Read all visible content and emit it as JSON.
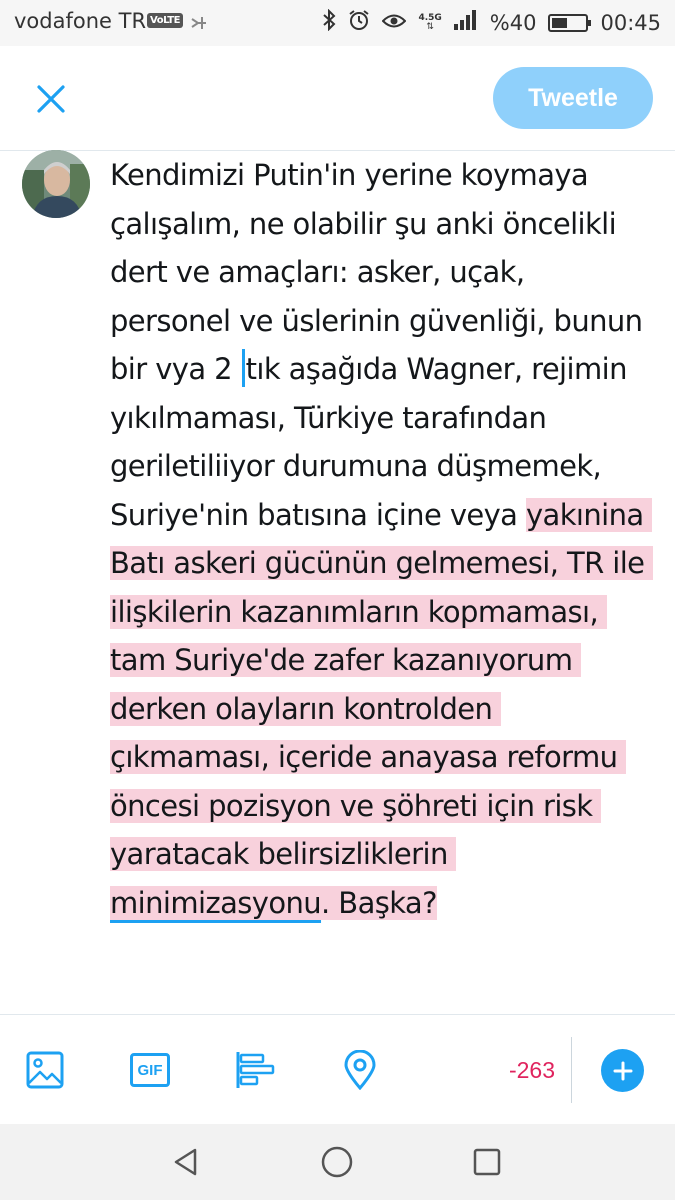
{
  "status_bar": {
    "carrier": "vodafone TR",
    "volte_badge": "VoLTE",
    "network_type": "4.5G",
    "battery": "%40",
    "battery_level": 0.4,
    "time": "00:45"
  },
  "header": {
    "tweet_button_label": "Tweetle",
    "tweet_button_color": "#8fd0fb"
  },
  "composer": {
    "text_before_cursor": "Kendimizi Putin'in yerine koymaya çalışalım, ne olabilir şu anki öncelikli dert ve amaçları: asker, uçak, personel ve üslerinin güvenliği, bunun bir vya 2 ",
    "text_after_cursor": "tık aşağıda Wagner, rejimin yıkılmaması, Türkiye tarafından geriletiliiyor durumuna düşmemek, Suriye'nin batısına içine veya ",
    "overflow_text": "yakınina Batı askeri gücünün gelmemesi, TR ile ilişkilerin kazanımların kopmaması, tam Suriye'de zafer kazanıyorum derken olayların kontrolden çıkmaması, içeride anayasa reformu öncesi pozisyon ve şöhreti için risk yaratacak belirsizliklerin ",
    "misspelled_word": "minimizasyonu",
    "overflow_tail": ". Başka?",
    "overflow_highlight_color": "#f8d1dc",
    "cursor_color": "#1da1f2"
  },
  "toolbar": {
    "icons": [
      "image-icon",
      "gif-icon",
      "poll-icon",
      "location-icon",
      "add-icon"
    ],
    "gif_label": "GIF",
    "char_count": "-263",
    "char_count_color": "#e0245e",
    "accent_color": "#1da1f2"
  },
  "nav_bar": {
    "icons": [
      "back-icon",
      "home-icon",
      "recents-icon"
    ]
  }
}
